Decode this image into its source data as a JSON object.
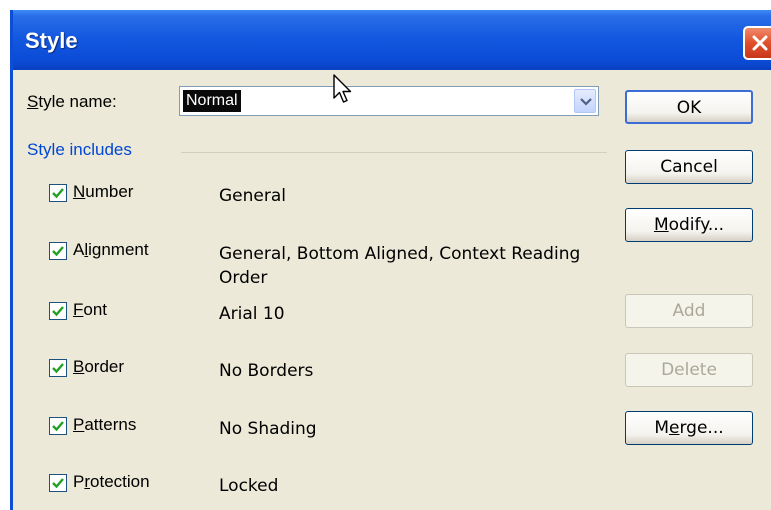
{
  "window": {
    "title": "Style"
  },
  "style_name": {
    "label_prefix": "S",
    "label_rest": "tyle name:",
    "value": "Normal"
  },
  "group": {
    "label": "Style includes"
  },
  "items": [
    {
      "accel": "N",
      "rest": "umber",
      "value": "General",
      "checked": true
    },
    {
      "accel_pre": "A",
      "accel": "l",
      "rest": "ignment",
      "value": "General, Bottom Aligned, Context Reading Order",
      "checked": true
    },
    {
      "accel": "F",
      "rest": "ont",
      "value": "Arial 10",
      "checked": true
    },
    {
      "accel": "B",
      "rest": "order",
      "value": "No Borders",
      "checked": true
    },
    {
      "accel": "P",
      "rest": "atterns",
      "value": "No Shading",
      "checked": true
    },
    {
      "accel_pre": "P",
      "accel": "r",
      "rest": "otection",
      "value": "Locked",
      "checked": true
    }
  ],
  "buttons": {
    "ok": "OK",
    "cancel": "Cancel",
    "modify_accel": "M",
    "modify_rest": "odify...",
    "add": "Add",
    "delete": "Delete",
    "merge_pre": "M",
    "merge_accel": "e",
    "merge_rest": "rge..."
  },
  "icons": {
    "close": "close-icon",
    "dropdown": "chevron-down-icon",
    "check": "check-icon",
    "cursor": "mouse-pointer-icon"
  },
  "colors": {
    "titlebar": "#0b4bd6",
    "group_label": "#0046d5",
    "dialog_bg": "#ece9d8",
    "close": "#e0502c"
  }
}
